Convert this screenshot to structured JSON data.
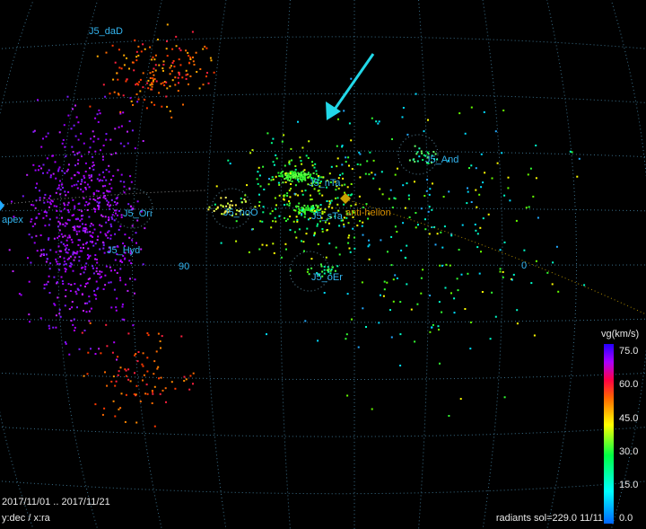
{
  "chart_data": {
    "type": "scatter",
    "projection_label": "y:dec / x:ra",
    "date_range": "2017/11/01 .. 2017/11/21",
    "status_text": "radiants sol=229.0 11/11",
    "apex_label": "apex",
    "antihelion_label": "anti-helion",
    "meridian_labels": [
      "90",
      "0"
    ],
    "showers": [
      {
        "name": "J5_daD"
      },
      {
        "name": "J5_Ori"
      },
      {
        "name": "J5_Hyd"
      },
      {
        "name": "J5_noO"
      },
      {
        "name": "J5_nTa"
      },
      {
        "name": "J5_sTa"
      },
      {
        "name": "J5_And"
      },
      {
        "name": "J5_oEr"
      }
    ],
    "colorbar": {
      "title": "vg(km/s)",
      "ticks": [
        "75.0",
        "60.0",
        "45.0",
        "30.0",
        "15.0",
        "0.0"
      ],
      "range": [
        0,
        80
      ],
      "colors": [
        "#0066ff",
        "#00ffff",
        "#00ff44",
        "#ffff00",
        "#ff6600",
        "#ff0044",
        "#aa00ff",
        "#2200ff"
      ]
    },
    "arrow_color": "#22d8e8",
    "grid": true
  }
}
